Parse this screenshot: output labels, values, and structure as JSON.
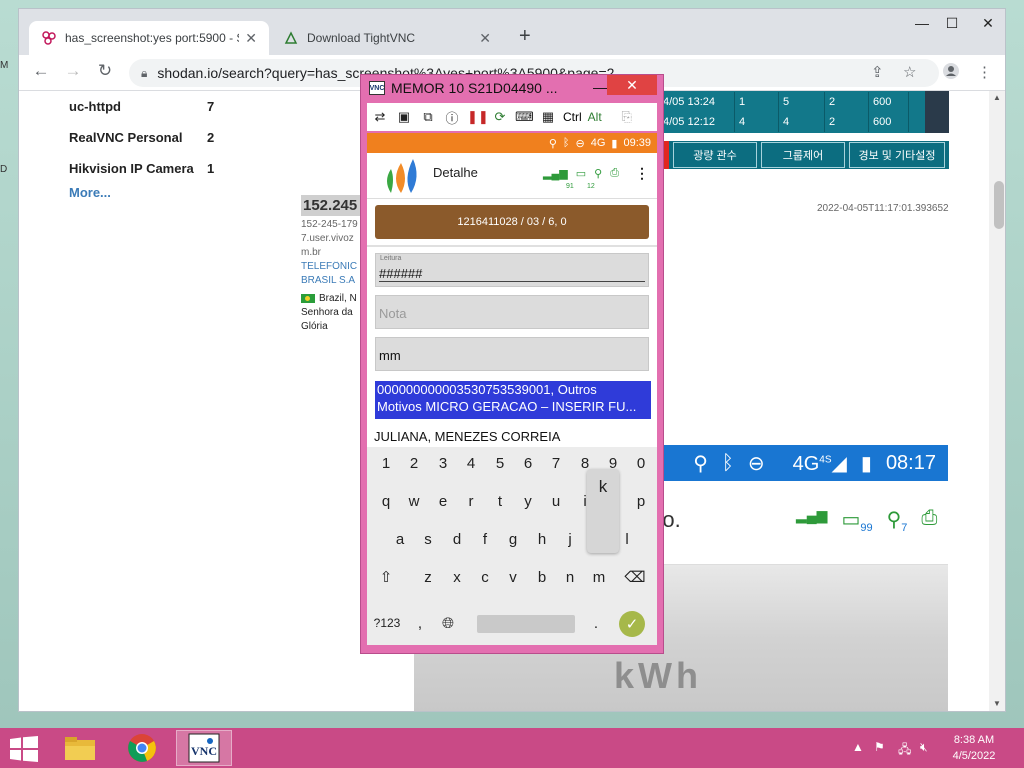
{
  "desktop": {
    "marks": [
      "M",
      "D"
    ]
  },
  "browser": {
    "tabs": [
      {
        "label": "has_screenshot:yes port:5900 - S",
        "active": true
      },
      {
        "label": "Download TightVNC",
        "active": false
      }
    ],
    "new_tab": "+",
    "url": "shodan.io/search?query=has_screenshot%3Ayes+port%3A5900&page=2",
    "window_controls": {
      "minimize": "—",
      "maximize": "☐",
      "close": "✕"
    }
  },
  "shodan": {
    "facets": [
      {
        "name": "uc-httpd",
        "count": "7"
      },
      {
        "name": "RealVNC Personal",
        "count": "2"
      },
      {
        "name": "Hikvision IP Camera",
        "count": "1"
      }
    ],
    "more": "More...",
    "result": {
      "ip": "152.245",
      "hostname_1": "152-245-179",
      "hostname_2": "7.user.vivoz",
      "hostname_3": "m.br",
      "org_1": "TELEFÔNIC",
      "org_2": "BRASIL S.A",
      "country": "Brazil, N",
      "city_1": "Senhora da",
      "city_2": "Glória",
      "timestamp": "2022-04-05T11:17:01.393652"
    },
    "kr_table": {
      "rows": [
        [
          "4/05 13:24",
          "1",
          "5",
          "2",
          "600"
        ],
        [
          "4/05 12:12",
          "4",
          "4",
          "2",
          "600"
        ]
      ],
      "buttons": [
        "광량 관수",
        "그룹제어",
        "경보 및 기타설정"
      ]
    },
    "android": {
      "network": "4G",
      "network_sup": "4S",
      "time": "08:17",
      "partial_text": "oto.",
      "battery_badge": "99",
      "gps_badge": "7",
      "blur_text": "kWh"
    }
  },
  "vnc": {
    "title": "MEMOR 10 S21D04490 ...",
    "logo": "VNC",
    "toolbar": {
      "ctrl": "Ctrl",
      "alt": "Alt"
    },
    "app": {
      "status_network": "4G",
      "status_time": "09:39",
      "title": "Detalhe",
      "battery_badge": "91",
      "gps_badge": "12",
      "record": "1216411028 / 03 / 6, 0",
      "leitura_label": "Leitura",
      "leitura_value": "######",
      "nota_placeholder": "Nota",
      "mm_value": "mm",
      "blue_line_1": "000000000003530753539001, Outros",
      "blue_line_2": "Motivos MICRO GERACAO – INSERIR FU...",
      "client_name": "JULIANA, MENEZES CORREIA"
    },
    "keyboard": {
      "digits": [
        "1",
        "2",
        "3",
        "4",
        "5",
        "6",
        "7",
        "8",
        "9",
        "0"
      ],
      "row1": [
        "q",
        "w",
        "e",
        "r",
        "t",
        "y",
        "u",
        "i",
        "o",
        "p"
      ],
      "row2": [
        "a",
        "s",
        "d",
        "f",
        "g",
        "h",
        "j",
        "k",
        "l"
      ],
      "row3": [
        "z",
        "x",
        "c",
        "v",
        "b",
        "n",
        "m"
      ],
      "popup": "k",
      "sym": "?123",
      "comma": ",",
      "period": "."
    }
  },
  "taskbar": {
    "time": "8:38 AM",
    "date": "4/5/2022"
  }
}
